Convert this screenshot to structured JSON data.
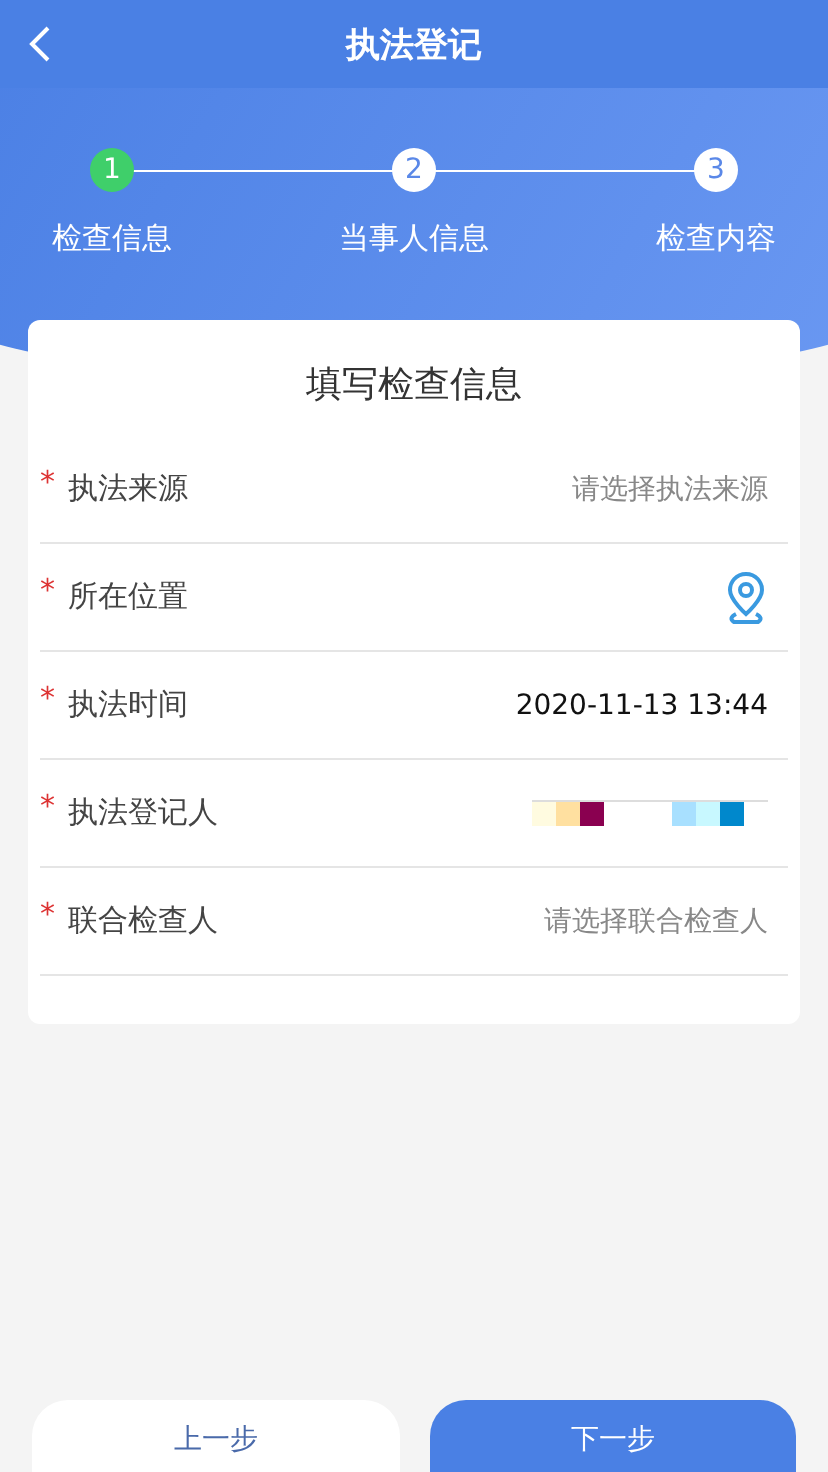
{
  "header": {
    "title": "执法登记"
  },
  "steps": [
    {
      "number": "1",
      "label": "检查信息",
      "selected": true
    },
    {
      "number": "2",
      "label": "当事人信息",
      "selected": false
    },
    {
      "number": "3",
      "label": "检查内容",
      "selected": false
    }
  ],
  "form": {
    "title": "填写检查信息",
    "fields": [
      {
        "kind": "select",
        "label": "执法来源",
        "required": "*",
        "placeholder": "请选择执法来源"
      },
      {
        "kind": "location",
        "label": "所在位置",
        "required": "*"
      },
      {
        "kind": "text",
        "label": "执法时间",
        "required": "*",
        "value": "2020-11-13 13:44"
      },
      {
        "kind": "redacted",
        "label": "执法登记人",
        "required": "*"
      },
      {
        "kind": "select",
        "label": "联合检查人",
        "required": "*",
        "placeholder": "请选择联合检查人"
      }
    ]
  },
  "buttons": {
    "prev": "上一步",
    "next": "下一步"
  }
}
